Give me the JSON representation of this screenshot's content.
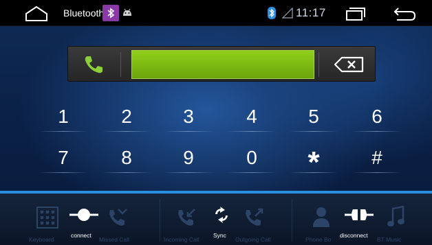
{
  "status_bar": {
    "title": "Bluetooth",
    "time": "11:17"
  },
  "dial": {
    "number": ""
  },
  "keypad": {
    "keys": [
      "1",
      "2",
      "3",
      "4",
      "5",
      "6",
      "7",
      "8",
      "9",
      "0",
      "*",
      "#"
    ]
  },
  "bottom_bar": {
    "keyboard_label": "Keyboard",
    "missed_call_label": "Missed Call",
    "incoming_call_label": "Incoming Call",
    "outgoing_call_label": "Outgoing Call",
    "phone_book_label": "Phone Bo",
    "bt_music_label": "BT Music",
    "connect_label": "connect",
    "sync_label": "Sync",
    "disconnect_label": "disconnect"
  },
  "colors": {
    "accent_line": "#2b8fe0",
    "dial_field": "#7bb913",
    "call_icon": "#8ccf3a",
    "bluetooth_badge": "#8a3aa6"
  }
}
